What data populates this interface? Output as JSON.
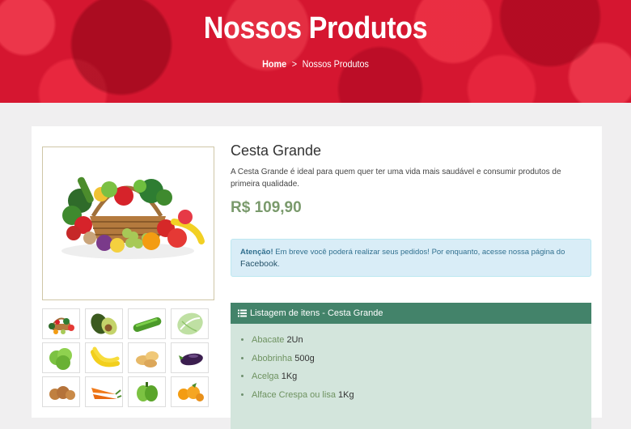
{
  "hero": {
    "title": "Nossos Produtos",
    "breadcrumb": {
      "home": "Home",
      "separator": ">",
      "current": "Nossos Produtos"
    }
  },
  "product": {
    "name": "Cesta Grande",
    "description": "A Cesta Grande é ideal para quem quer ter uma vida mais saudável e consumir produtos de primeira qualidade.",
    "price": "R$ 109,90",
    "main_image": "fruit-basket-image",
    "thumbnails": [
      "fruit-basket-thumb",
      "avocado-thumb",
      "cucumber-thumb",
      "cabbage-thumb",
      "lettuce-thumb",
      "banana-thumb",
      "potato-thumb",
      "eggplant-thumb",
      "onion-thumb",
      "carrot-thumb",
      "pepper-thumb",
      "tangerine-thumb"
    ]
  },
  "alert": {
    "strong": "Atenção!",
    "text": " Em breve você poderá realizar seus pedidos! Por enquanto, acesse nossa página do",
    "link": "Facebook",
    "end": "."
  },
  "items_panel": {
    "icon": "list-icon",
    "title": "Listagem de itens - Cesta Grande",
    "items": [
      {
        "name": "Abacate",
        "qty": "2Un"
      },
      {
        "name": "Abobrinha",
        "qty": "500g"
      },
      {
        "name": "Acelga",
        "qty": "1Kg"
      },
      {
        "name": "Alface Crespa ou lisa",
        "qty": "1Kg"
      }
    ]
  },
  "colors": {
    "hero_red": "#d51630",
    "panel_green": "#43836a",
    "panel_bg": "#d3e5dc",
    "price": "#7a9a6c",
    "alert_bg": "#d9edf7"
  }
}
